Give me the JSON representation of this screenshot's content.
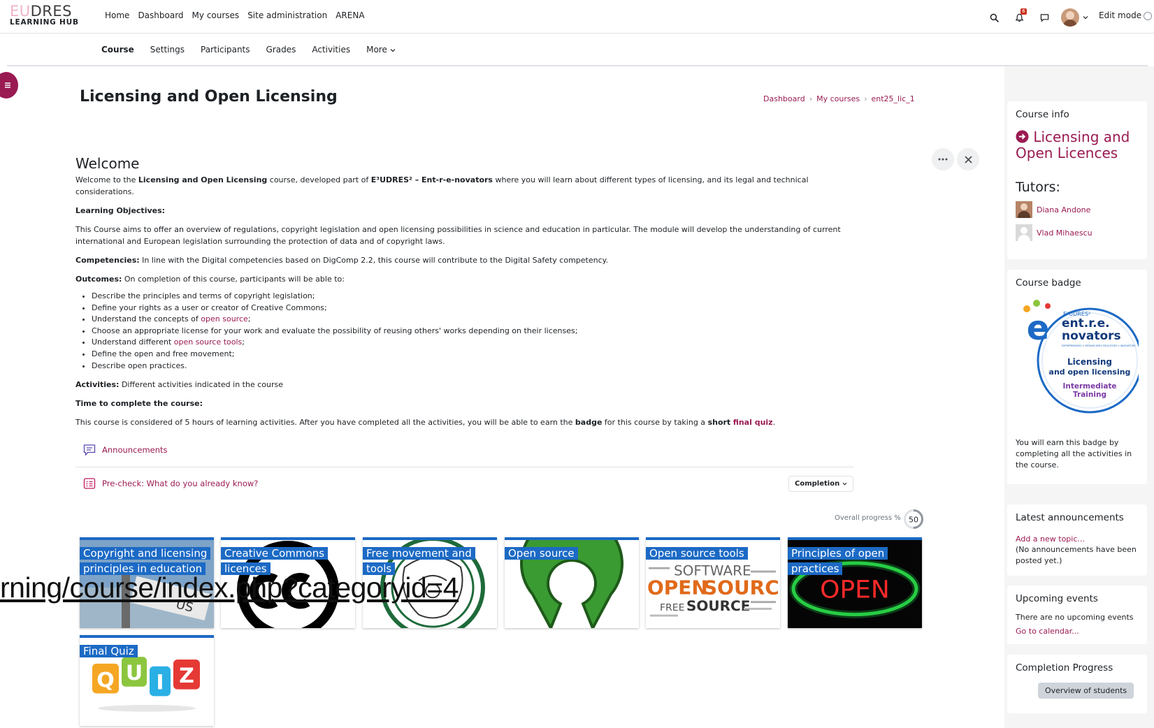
{
  "brand": {
    "line1_a": "EU",
    "line1_b": "DRES",
    "line2": "LEARNING HUB"
  },
  "primary_nav": [
    "Home",
    "Dashboard",
    "My courses",
    "Site administration",
    "ARENA"
  ],
  "top_icons": {
    "search": "search-icon",
    "notifications": "bell-icon",
    "notification_count": "6",
    "messages": "chat-icon"
  },
  "edit_mode_label": "Edit mode",
  "secondary_nav": [
    "Course",
    "Settings",
    "Participants",
    "Grades",
    "Activities",
    "More"
  ],
  "page_title": "Licensing and Open Licensing",
  "breadcrumb": [
    "Dashboard",
    "My courses",
    "ent25_lic_1"
  ],
  "summary": {
    "heading": "Welcome",
    "intro_a": "Welcome to the ",
    "intro_b": "Licensing and Open Licensing",
    "intro_c": " course, developed part of ",
    "intro_d": "E³UDRES² – Ent-r-e-novators",
    "intro_e": " where you will learn about different types of licensing, and its legal and technical considerations.",
    "objectives_label": "Learning Objectives:",
    "objectives_text": "This Course aims to offer an overview of regulations, copyright legislation and open licensing possibilities in science and education in particular. The module will develop the understanding of current international and European legislation surrounding the protection of data and of copyright laws.",
    "competencies_label": "Competencies:",
    "competencies_text": " In line with the Digital competencies based on DigComp 2.2, this course will contribute to the Digital Safety competency.",
    "outcomes_label": "Outcomes:",
    "outcomes_text": " On completion of this course, participants will be able to:",
    "outcomes": [
      {
        "pre": "Describe the principles and terms of copyright legislation;",
        "link": "",
        "post": ""
      },
      {
        "pre": "Define your rights as a user or creator of Creative Commons;",
        "link": "",
        "post": ""
      },
      {
        "pre": "Understand the concepts of ",
        "link": "open source",
        "post": ";"
      },
      {
        "pre": "Choose an appropriate license for your  work and evaluate the possibility of reusing others' works depending on their licenses;",
        "link": "",
        "post": ""
      },
      {
        "pre": "Understand different ",
        "link": "open source tools",
        "post": ";"
      },
      {
        "pre": "Define the open and free movement;",
        "link": "",
        "post": ""
      },
      {
        "pre": "Describe open practices.",
        "link": "",
        "post": ""
      }
    ],
    "activities_label": "Activities:",
    "activities_text": " Different activities indicated in the course",
    "time_label": "Time to complete the course:",
    "time_a": "This course is considered of 5 hours of learning activities. After you have completed all the activities, you will be able to earn the ",
    "time_b": "badge",
    "time_c": " for this course by taking a ",
    "time_d": "short",
    "time_e": "final quiz",
    "time_f": "."
  },
  "activities": [
    {
      "name": "Announcements",
      "icon": "forum-icon"
    },
    {
      "name": "Pre-check: What do you already know?",
      "icon": "quiz-icon"
    }
  ],
  "completion_label": "Completion",
  "overall_progress_label": "Overall progress %",
  "overall_progress_value": 50,
  "tiles": [
    "Copyright and licensing principles in education",
    "Creative Commons licences",
    "Free movement and tools",
    "Open source",
    "Open source tools",
    "Principles of open practices",
    "Final Quiz"
  ],
  "tile_art_text": {
    "open_sign": "OPEN",
    "quiz": [
      "Q",
      "U",
      "I",
      "Z"
    ],
    "wordcloud": [
      "SOFTWARE",
      "OPEN",
      "SOURCE",
      "FREE",
      "SOURCE"
    ]
  },
  "url_overlay": "rning/course/index.php?categoryid=4",
  "drawer": {
    "course_info_title": "Course info",
    "course_name": "Licensing and Open Licences",
    "tutors_title": "Tutors:",
    "tutors": [
      "Diana Andone",
      "Vlad Mihaescu"
    ],
    "badge_title": "Course badge",
    "badge": {
      "top": "E³UDRES²",
      "brand1": "ent.r.e.",
      "brand2": "novators",
      "tagline": "ENTREPRENEURS × RESEARCHERS EDUCATORS × INNOVATORS",
      "title1": "Licensing",
      "title2": "and open licensing",
      "level1": "Intermediate",
      "level2": "Training"
    },
    "badge_text": "You will earn this badge by completing all the activities in the course.",
    "announcements_title": "Latest announcements",
    "add_topic": "Add a new topic...",
    "no_announcements": "(No announcements have been posted yet.)",
    "events_title": "Upcoming events",
    "no_events": "There are no upcoming events",
    "calendar_link": "Go to calendar...",
    "completion_title": "Completion Progress",
    "overview_button": "Overview of students"
  },
  "colors": {
    "brand": "#9a1a52",
    "tile_blue": "#1c6ac5",
    "drawer_bg": "#f5f5f5"
  }
}
